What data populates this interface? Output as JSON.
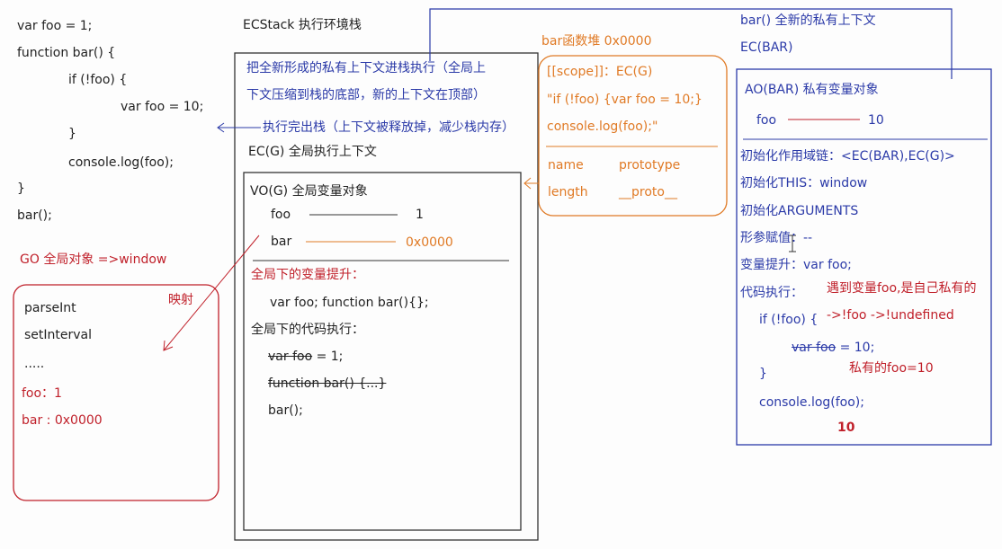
{
  "code": {
    "l1": "var foo = 1;",
    "l2": "function bar() {",
    "l3": "if (!foo) {",
    "l4": "var foo = 10;",
    "l5": "}",
    "l6": "console.log(foo);",
    "l7": "}",
    "l8": "bar();"
  },
  "go": {
    "title": "GO 全局对象 =>window",
    "items": [
      "parseInt",
      "setInterval",
      "....."
    ],
    "foo": "foo：1",
    "bar": "bar : 0x0000",
    "mapping": "映射"
  },
  "ecstack": {
    "title": "ECStack   执行环境栈",
    "note1": "把全新形成的私有上下文进栈执行（全局上",
    "note2": "下文压缩到栈的底部，新的上下文在顶部）",
    "note3": "执行完出栈（上下文被释放掉，减少栈内存）",
    "ecg": "EC(G)   全局执行上下文"
  },
  "vog": {
    "title": "VO(G)  全局变量对象",
    "foo_name": "foo",
    "foo_val": "1",
    "bar_name": "bar",
    "bar_val": "0x0000",
    "hoist_title": "全局下的变量提升：",
    "hoist_body": "var foo;    function bar(){};",
    "exec_title": "全局下的代码执行：",
    "exec1": "var foo",
    "exec1b": " = 1;",
    "exec2": "function bar() {...}",
    "exec3": "bar();"
  },
  "heap": {
    "title": "bar函数堆  0x0000",
    "scope": "[[scope]]：EC(G)",
    "code1": "\"if (!foo) {var foo = 10;}",
    "code2": "console.log(foo);\"",
    "name": "name",
    "prototype": "prototype",
    "length": "length",
    "proto": "__proto__"
  },
  "ecbar": {
    "title1": "bar() 全新的私有上下文",
    "title2": "EC(BAR)",
    "ao": "AO(BAR) 私有变量对象",
    "foo_name": "foo",
    "foo_val": "10",
    "scope_chain": "初始化作用域链：<EC(BAR),EC(G)>",
    "this": "初始化THIS：window",
    "arguments": "初始化ARGUMENTS",
    "params": "形参赋值：--",
    "hoist": "变量提升：var foo;",
    "exec": "代码执行：",
    "exec_note": "遇到变量foo,是自己私有的",
    "if_line": "if (!foo) {",
    "if_eval": "->!foo  ->!undefined",
    "assign_a": "var foo",
    "assign_b": " = 10;",
    "private_note": "私有的foo=10",
    "close": "}",
    "log": "console.log(foo);",
    "result": "10"
  }
}
